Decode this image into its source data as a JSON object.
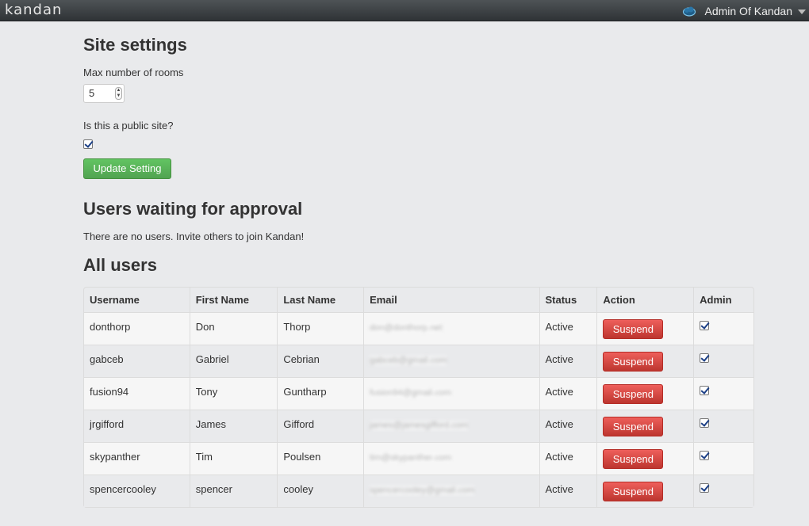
{
  "topbar": {
    "logo": "kandan",
    "user_name": "Admin Of Kandan"
  },
  "site_settings": {
    "title": "Site settings",
    "max_rooms_label": "Max number of rooms",
    "max_rooms_value": "5",
    "public_label": "Is this a public site?",
    "public_checked": true,
    "update_button": "Update Setting"
  },
  "waiting": {
    "title": "Users waiting for approval",
    "empty_text": "There are no users. Invite others to join Kandan!"
  },
  "all_users": {
    "title": "All users",
    "columns": [
      "Username",
      "First Name",
      "Last Name",
      "Email",
      "Status",
      "Action",
      "Admin"
    ],
    "rows": [
      {
        "username": "donthorp",
        "first": "Don",
        "last": "Thorp",
        "email": "don@donthorp.net",
        "status": "Active",
        "action": "Suspend",
        "admin": true
      },
      {
        "username": "gabceb",
        "first": "Gabriel",
        "last": "Cebrian",
        "email": "gabceb@gmail.com",
        "status": "Active",
        "action": "Suspend",
        "admin": true
      },
      {
        "username": "fusion94",
        "first": "Tony",
        "last": "Guntharp",
        "email": "fusion94@gmail.com",
        "status": "Active",
        "action": "Suspend",
        "admin": true
      },
      {
        "username": "jrgifford",
        "first": "James",
        "last": "Gifford",
        "email": "james@jamesgifford.com",
        "status": "Active",
        "action": "Suspend",
        "admin": true
      },
      {
        "username": "skypanther",
        "first": "Tim",
        "last": "Poulsen",
        "email": "tim@skypanther.com",
        "status": "Active",
        "action": "Suspend",
        "admin": true
      },
      {
        "username": "spencercooley",
        "first": "spencer",
        "last": "cooley",
        "email": "spencercooley@gmail.com",
        "status": "Active",
        "action": "Suspend",
        "admin": true
      }
    ]
  }
}
